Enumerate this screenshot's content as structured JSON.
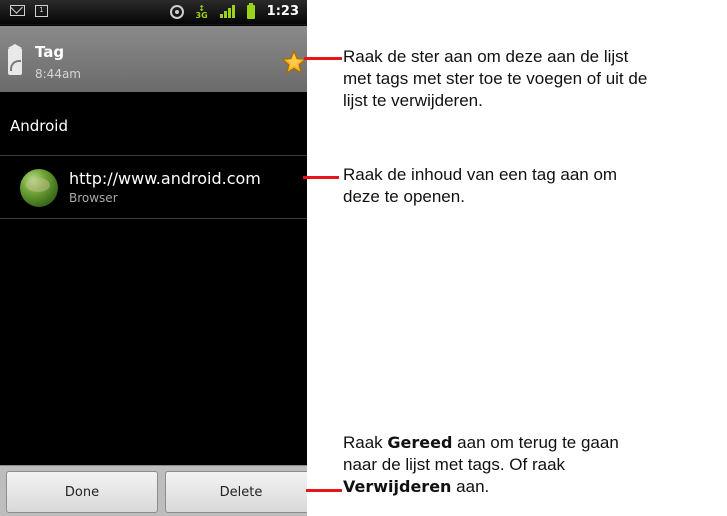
{
  "status_bar": {
    "calendar_day": "1",
    "network": "3G",
    "time": "1:23",
    "icons": [
      "gmail-icon",
      "calendar-icon",
      "gps-icon",
      "network-3g-icon",
      "signal-icon",
      "battery-icon"
    ]
  },
  "title_bar": {
    "title": "Tag",
    "time": "8:44am",
    "star_color": "#f5a623"
  },
  "section": {
    "label": "Android"
  },
  "tag_item": {
    "url": "http://www.android.com",
    "subtitle": "Browser"
  },
  "buttons": {
    "done": "Done",
    "delete": "Delete"
  },
  "annotations": {
    "star": {
      "line1": "Raak de ster aan om deze aan de lijst",
      "line2": "met tags met ster toe te voegen of uit de",
      "line3": "lijst te verwijderen."
    },
    "content": {
      "line1": "Raak de inhoud van een tag aan om",
      "line2": "deze te openen."
    },
    "done": {
      "prefix": "Raak ",
      "bold1": "Gereed",
      "suffix1": " aan om terug te gaan",
      "line2": "naar de lijst met tags. Of raak",
      "bold2": "Verwijderen",
      "suffix2": " aan."
    }
  },
  "accent_color": "#e8151b"
}
